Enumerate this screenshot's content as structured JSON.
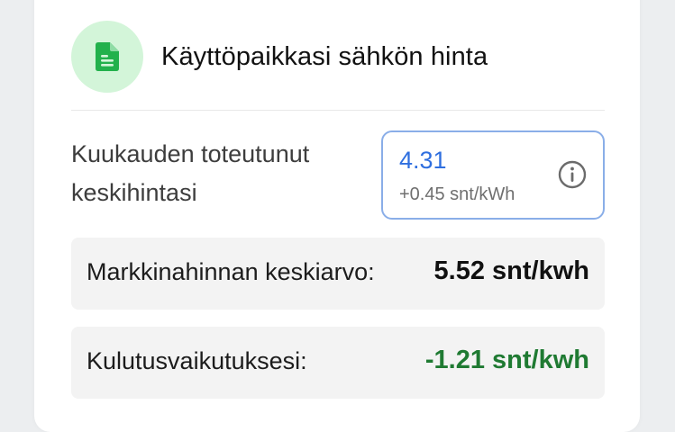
{
  "header": {
    "title": "Käyttöpaikkasi sähkön hinta",
    "icon": "document-icon",
    "icon_color": "#22b14c",
    "icon_bg": "#d3f5d9"
  },
  "monthly_price": {
    "label": "Kuukauden toteutunut keskihintasi",
    "value": "4.31",
    "difference": "+0.45 snt/kWh",
    "value_color": "#2f6fdf",
    "info_icon": "info-icon"
  },
  "market_average": {
    "label": "Markkinahinnan keskiarvo:",
    "value": "5.52 snt/kwh"
  },
  "consumption_effect": {
    "label": "Kulutusvaikutuksesi:",
    "value": "-1.21 snt/kwh",
    "value_color": "#1f7a32"
  }
}
